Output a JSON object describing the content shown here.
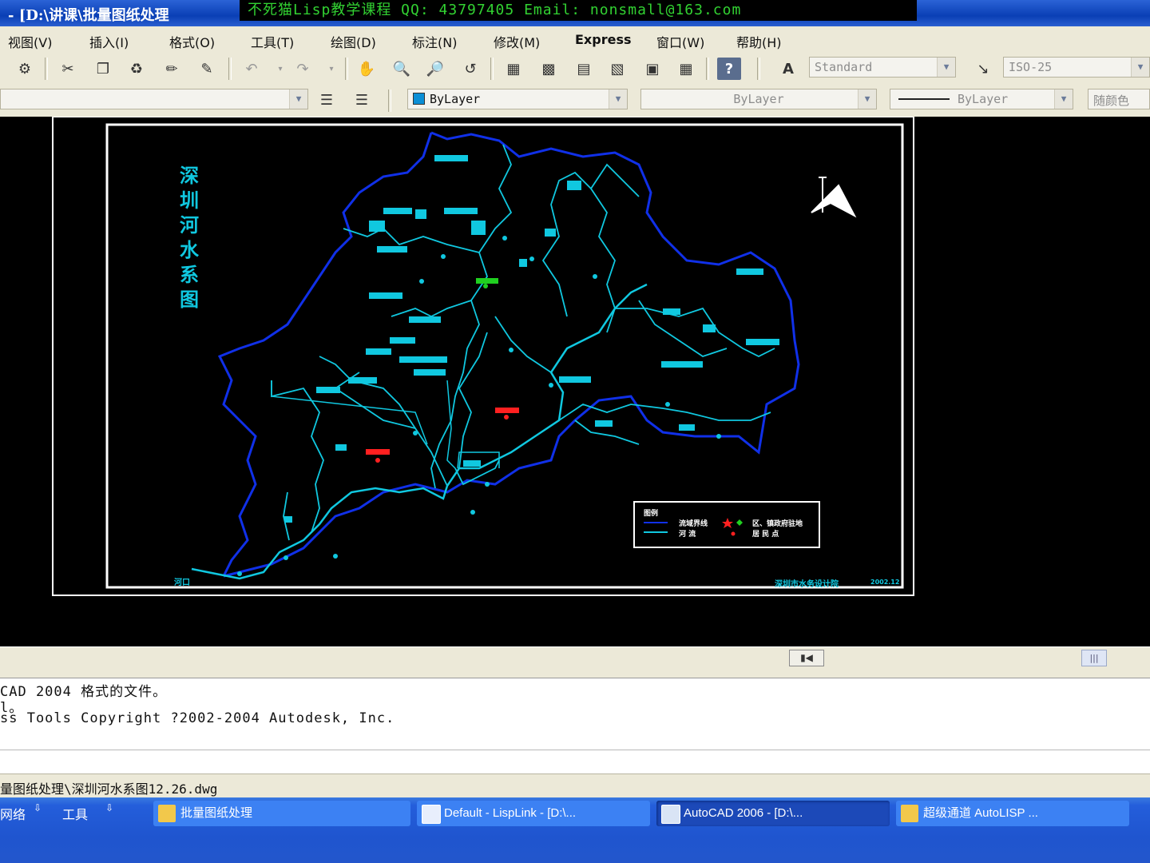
{
  "window": {
    "title": "- [D:\\讲课\\批量图纸处理",
    "watermark": "不死猫Lisp教学课程 QQ: 43797405 Email: nonsmall@163.com"
  },
  "menu": [
    "视图(V)",
    "插入(I)",
    "格式(O)",
    "工具(T)",
    "绘图(D)",
    "标注(N)",
    "修改(M)",
    "Express",
    "窗口(W)",
    "帮助(H)"
  ],
  "toolbar": {
    "text_style": "Standard",
    "dim_style": "ISO-25",
    "layer": "ByLayer",
    "color": "ByLayer",
    "linetype": "ByLayer",
    "plot_style": "随颜色"
  },
  "drawing": {
    "title_vertical": [
      "深",
      "圳",
      "河",
      "水",
      "系",
      "图"
    ],
    "footer_org": "深圳市水务设计院",
    "footer_year": "2002.12",
    "mouth_label": "河口",
    "legend": {
      "title": "图例",
      "row1_a": "流域界线",
      "row1_b": "区、镇政府驻地",
      "row2_a": "河 流",
      "row2_b": "居 民 点"
    }
  },
  "command": {
    "lines": [
      "CAD 2004 格式的文件。",
      "l。",
      "ss Tools Copyright ?2002-2004 Autodesk, Inc."
    ]
  },
  "status": {
    "path": "量图纸处理\\深圳河水系图12.26.dwg"
  },
  "taskbar": {
    "left_1": "网络",
    "left_2": "工具",
    "items": [
      "批量图纸处理",
      "Default - LispLink - [D:\\...",
      "AutoCAD 2006 - [D:\\...",
      "超级通道 AutoLISP ..."
    ]
  },
  "colors": {
    "river": "#10c8e0",
    "boundary": "#1030e8",
    "town": "#ff2020",
    "green_town": "#20d020"
  }
}
